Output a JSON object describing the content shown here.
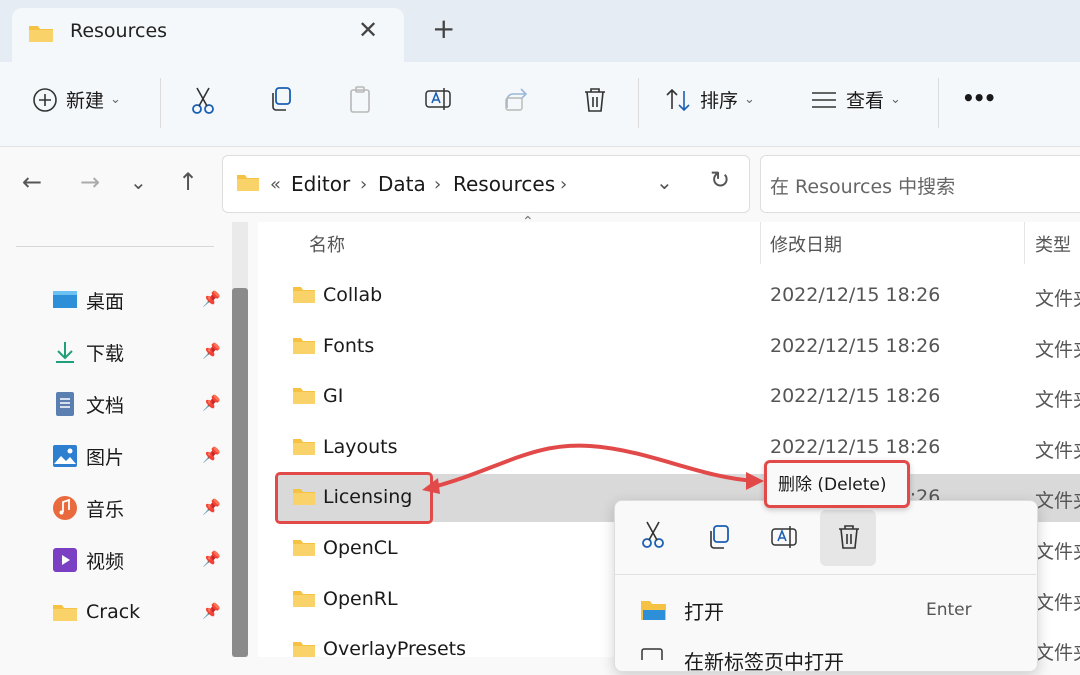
{
  "tab": {
    "title": "Resources",
    "close": "✕",
    "new_tab": "+"
  },
  "toolbar": {
    "new_label": "新建",
    "sort_label": "排序",
    "view_label": "查看",
    "more": "•••"
  },
  "address": {
    "ellipsis": "«",
    "crumbs": [
      "Editor",
      "Data",
      "Resources"
    ],
    "sep": "›"
  },
  "search": {
    "placeholder": "在 Resources 中搜索"
  },
  "sidebar": {
    "items": [
      "桌面",
      "下载",
      "文档",
      "图片",
      "音乐",
      "视频",
      "Crack"
    ]
  },
  "columns": {
    "name": "名称",
    "date": "修改日期",
    "type": "类型"
  },
  "files": [
    {
      "name": "Collab",
      "date": "2022/12/15 18:26",
      "type": "文件夹"
    },
    {
      "name": "Fonts",
      "date": "2022/12/15 18:26",
      "type": "文件夹"
    },
    {
      "name": "GI",
      "date": "2022/12/15 18:26",
      "type": "文件夹"
    },
    {
      "name": "Layouts",
      "date": "2022/12/15 18:26",
      "type": "文件夹"
    },
    {
      "name": "Licensing",
      "date": "2022/12/15 18:26",
      "type": "文件夹"
    },
    {
      "name": "OpenCL",
      "date": "",
      "type": "文件夹"
    },
    {
      "name": "OpenRL",
      "date": "",
      "type": "文件夹"
    },
    {
      "name": "OverlayPresets",
      "date": "",
      "type": "文件夹"
    }
  ],
  "context_menu": {
    "open": "打开",
    "open_key": "Enter",
    "open_new_tab": "在新标签页中打开"
  },
  "tooltip": {
    "text": "删除 (Delete)"
  },
  "colors": {
    "accent": "#1a5fb4",
    "highlight": "#e24a4a",
    "folder": "#f5c244"
  }
}
